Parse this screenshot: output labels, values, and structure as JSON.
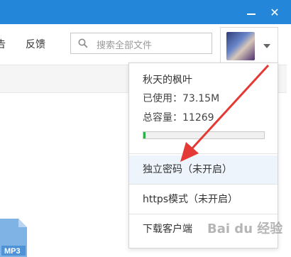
{
  "window": {
    "minimize_icon": "minimize-icon",
    "close_icon": "close-icon",
    "close_glyph": "✕"
  },
  "toolbar": {
    "link_left": "告",
    "link_feedback": "反馈"
  },
  "search": {
    "placeholder": "搜索全部文件",
    "icon": "search-icon"
  },
  "account_menu": {
    "user_name": "秋天的枫叶",
    "used_label": "已使用：73.15M",
    "total_label": "总容量：11269",
    "usage_fraction": 0.02,
    "items": [
      {
        "label": "独立密码（未开启）"
      },
      {
        "label": "https模式（未开启）"
      },
      {
        "label": "下载客户端"
      }
    ]
  },
  "file_badge": "MP3",
  "watermark": "Bai du 经验",
  "colors": {
    "titlebar": "#2386d8",
    "arrow": "#e53935",
    "progress": "#2bb14a"
  }
}
